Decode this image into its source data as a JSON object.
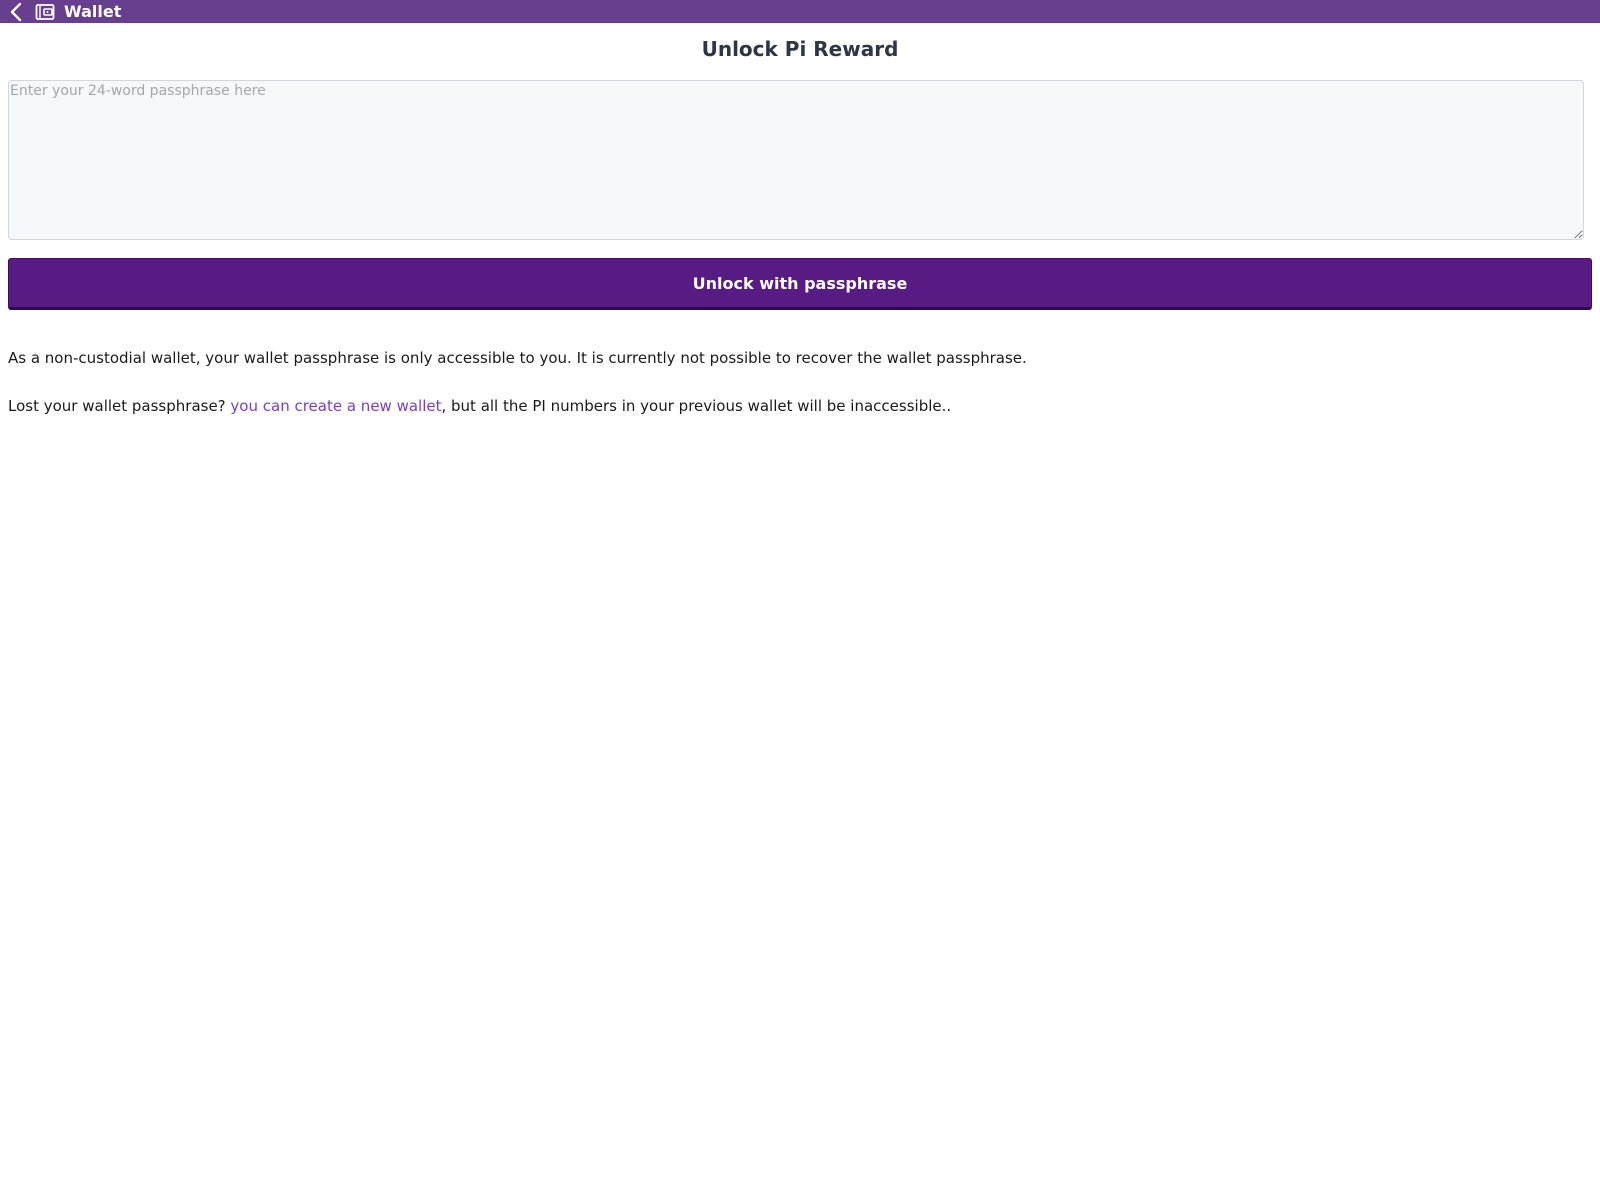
{
  "header": {
    "title": "Wallet",
    "back_icon": "chevron-left-icon",
    "app_icon": "wallet-icon",
    "bar_color": "#673f8e"
  },
  "main": {
    "title": "Unlock Pi Reward",
    "passphrase": {
      "value": "",
      "placeholder": "Enter your 24-word passphrase here"
    },
    "unlock_button_label": "Unlock with passphrase",
    "info_text": "As a non-custodial wallet, your wallet passphrase is only accessible to you. It is currently not possible to recover the wallet passphrase.",
    "lost_prefix": "Lost your wallet passphrase? ",
    "lost_link": "you can create a new wallet",
    "lost_suffix": ", but all the PI numbers in your previous wallet will be inaccessible..",
    "accent_color": "#581b83",
    "link_color": "#7a3fbf"
  }
}
